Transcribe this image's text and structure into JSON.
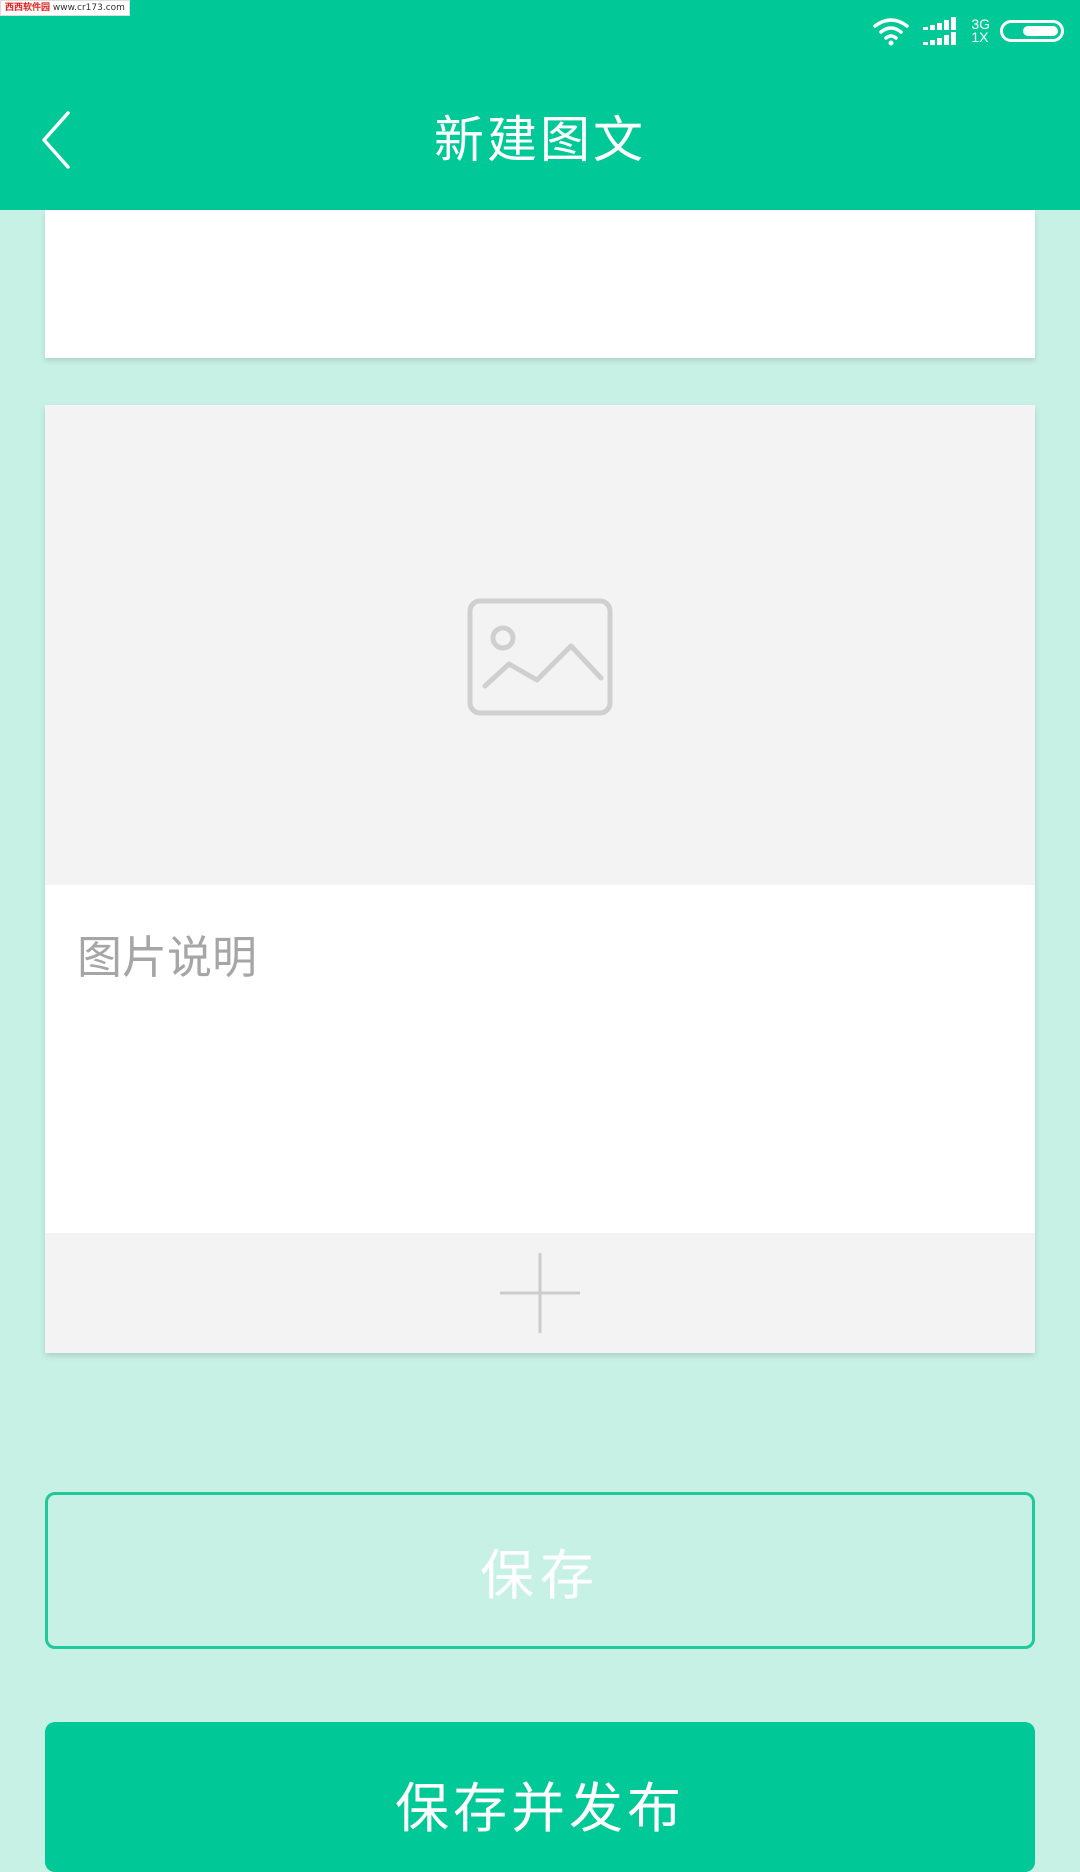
{
  "watermark": {
    "brand": "西西软件园",
    "url": "www.cr173.com"
  },
  "status_bar": {
    "network_top": "3G",
    "network_bottom": "1X",
    "icons": [
      "wifi-icon",
      "signal-icon",
      "battery-icon"
    ]
  },
  "header": {
    "title": "新建图文",
    "back_icon": "chevron-left-icon",
    "background": "#00c896"
  },
  "image_card": {
    "placeholder_icon": "image-icon",
    "caption_placeholder": "图片说明",
    "add_icon": "plus-icon"
  },
  "actions": {
    "save_label": "保存",
    "publish_label": "保存并发布"
  },
  "colors": {
    "accent": "#00c896",
    "page_bg": "#c7f1e5",
    "placeholder_gray": "#cfcfcf"
  }
}
